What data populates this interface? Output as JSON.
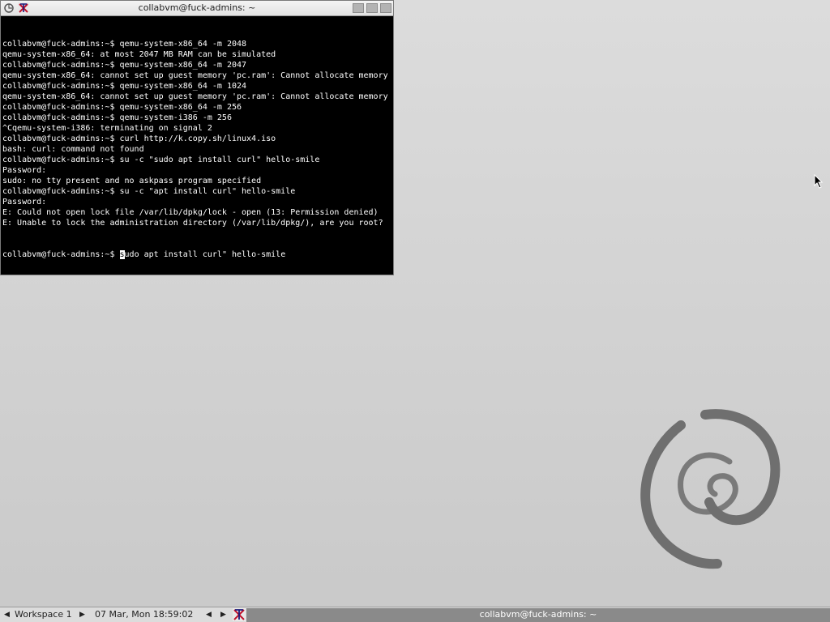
{
  "window": {
    "title": "collabvm@fuck-admins: ~"
  },
  "terminal": {
    "lines": [
      "collabvm@fuck-admins:~$ qemu-system-x86_64 -m 2048",
      "qemu-system-x86_64: at most 2047 MB RAM can be simulated",
      "collabvm@fuck-admins:~$ qemu-system-x86_64 -m 2047",
      "qemu-system-x86_64: cannot set up guest memory 'pc.ram': Cannot allocate memory",
      "collabvm@fuck-admins:~$ qemu-system-x86_64 -m 1024",
      "qemu-system-x86_64: cannot set up guest memory 'pc.ram': Cannot allocate memory",
      "collabvm@fuck-admins:~$ qemu-system-x86_64 -m 256",
      "collabvm@fuck-admins:~$ qemu-system-i386 -m 256",
      "^Cqemu-system-i386: terminating on signal 2",
      "collabvm@fuck-admins:~$ curl http://k.copy.sh/linux4.iso",
      "bash: curl: command not found",
      "collabvm@fuck-admins:~$ su -c \"sudo apt install curl\" hello-smile",
      "Password:",
      "sudo: no tty present and no askpass program specified",
      "collabvm@fuck-admins:~$ su -c \"apt install curl\" hello-smile",
      "Password:",
      "E: Could not open lock file /var/lib/dpkg/lock - open (13: Permission denied)",
      "E: Unable to lock the administration directory (/var/lib/dpkg/), are you root?"
    ],
    "prompt": "collabvm@fuck-admins:~$ ",
    "cursor_char": "s",
    "input_rest": "udo apt install curl\" hello-smile"
  },
  "taskbar": {
    "workspace": "Workspace 1",
    "clock": "07 Mar, Mon 18:59:02",
    "active_task": "collabvm@fuck-admins: ~"
  },
  "colors": {
    "terminal_bg": "#000000",
    "terminal_fg": "#ffffff",
    "active_task_bg": "#8a8a8a"
  }
}
